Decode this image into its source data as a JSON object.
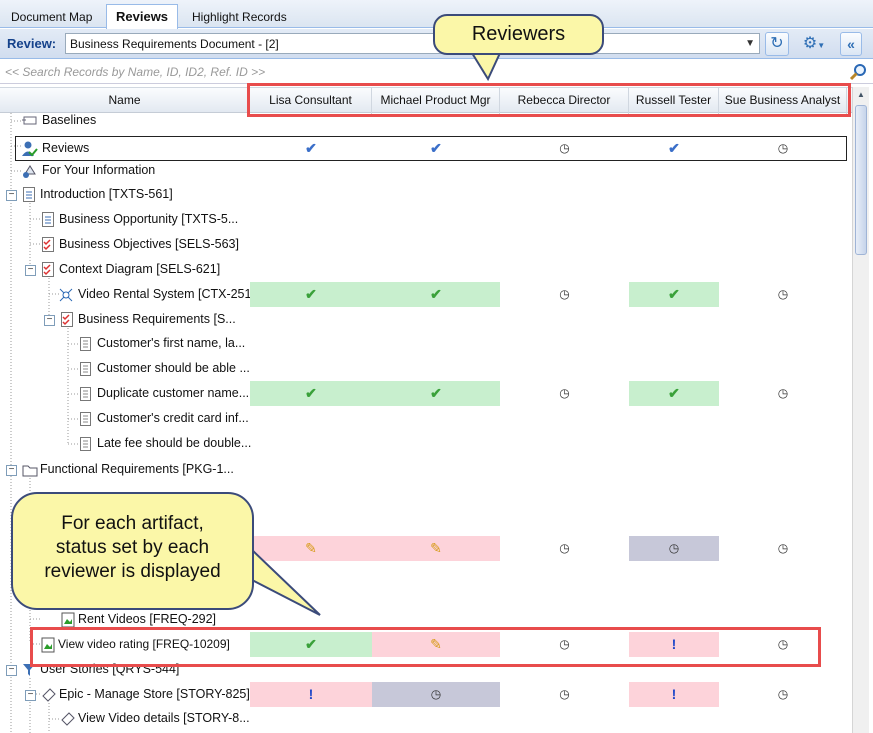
{
  "tabs": [
    {
      "label": "Document Map",
      "active": false
    },
    {
      "label": "Reviews",
      "active": true
    },
    {
      "label": "Highlight Records",
      "active": false
    }
  ],
  "review": {
    "label": "Review:",
    "selected": "Business Requirements Document - [2]"
  },
  "search": {
    "placeholder": "<< Search Records by Name, ID, ID2, Ref. ID >>"
  },
  "columns": {
    "name": "Name",
    "reviewers": [
      "Lisa Consultant",
      "Michael Product Mgr",
      "Rebecca Director",
      "Russell Tester",
      "Sue Business Analyst"
    ]
  },
  "rows": [
    {
      "label": "Baselines"
    },
    {
      "label": "Reviews"
    },
    {
      "label": "For Your Information"
    },
    {
      "label": "Introduction [TXTS-561]"
    },
    {
      "label": "Business Opportunity [TXTS-5..."
    },
    {
      "label": "Business Objectives [SELS-563]"
    },
    {
      "label": "Context Diagram [SELS-621]"
    },
    {
      "label": "Video Rental System [CTX-251]"
    },
    {
      "label": "Business Requirements [S..."
    },
    {
      "label": "Customer's first name, la..."
    },
    {
      "label": "Customer should be able ..."
    },
    {
      "label": "Duplicate customer name..."
    },
    {
      "label": "Customer's credit card inf..."
    },
    {
      "label": "Late fee should be double..."
    },
    {
      "label": "Functional Requirements [PKG-1..."
    },
    {
      "label": "Rent Videos [FREQ-292]"
    },
    {
      "label": "View video rating [FREQ-10209]"
    },
    {
      "label": "User Stories [QRYS-544]"
    },
    {
      "label": "Epic - Manage Store [STORY-825]"
    },
    {
      "label": "View Video details [STORY-8..."
    }
  ],
  "callouts": {
    "reviewers": "Reviewers",
    "status_line1": "For each artifact,",
    "status_line2": "status set by each",
    "status_line3": "reviewer is displayed"
  },
  "status_symbols": {
    "approved": "✔",
    "edit": "✎",
    "pending": "◷",
    "issue": "!"
  },
  "colors": {
    "approved_bg": "#c8efce",
    "rejected_bg": "#fdd3da",
    "waiting_bg": "#c7c8d9",
    "highlight": "#e84c4c",
    "callout": "#fbf7a8"
  }
}
